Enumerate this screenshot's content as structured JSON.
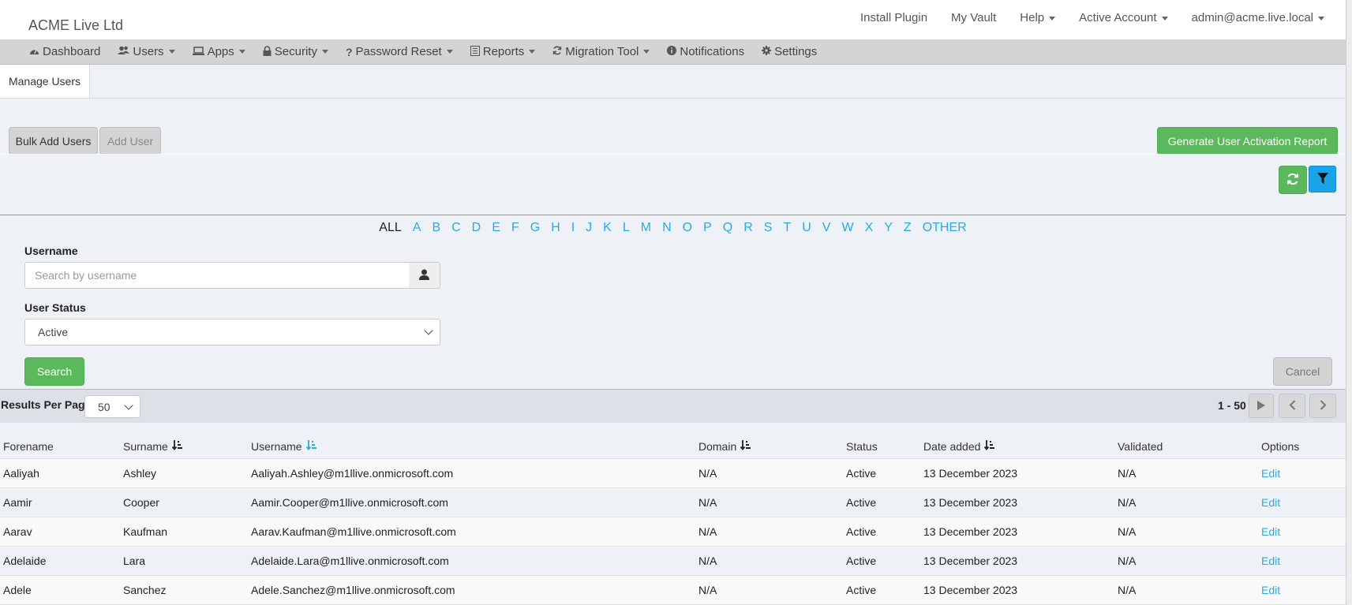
{
  "brand": "ACME Live Ltd",
  "topnav": {
    "install_plugin": "Install Plugin",
    "my_vault": "My Vault",
    "help": "Help",
    "active_account": "Active Account",
    "user": "admin@acme.live.local"
  },
  "mainnav": {
    "dashboard": "Dashboard",
    "users": "Users",
    "apps": "Apps",
    "security": "Security",
    "password_reset": "Password Reset",
    "reports": "Reports",
    "migration_tool": "Migration Tool",
    "notifications": "Notifications",
    "settings": "Settings"
  },
  "tab": {
    "manage_users": "Manage Users"
  },
  "actions": {
    "bulk_add": "Bulk Add Users",
    "add_user": "Add User",
    "generate_report": "Generate User Activation Report"
  },
  "alphabet": [
    "ALL",
    "A",
    "B",
    "C",
    "D",
    "E",
    "F",
    "G",
    "H",
    "I",
    "J",
    "K",
    "L",
    "M",
    "N",
    "O",
    "P",
    "Q",
    "R",
    "S",
    "T",
    "U",
    "V",
    "W",
    "X",
    "Y",
    "Z",
    "OTHER"
  ],
  "filters": {
    "username_label": "Username",
    "username_placeholder": "Search by username",
    "status_label": "User Status",
    "status_value": "Active",
    "search": "Search",
    "cancel": "Cancel"
  },
  "results": {
    "per_page_label": "Results Per Page",
    "per_page_value": "50",
    "range": "1 - 50"
  },
  "table": {
    "headers": {
      "forename": "Forename",
      "surname": "Surname",
      "username": "Username",
      "domain": "Domain",
      "status": "Status",
      "date_added": "Date added",
      "validated": "Validated",
      "options": "Options"
    },
    "rows": [
      {
        "forename": "Aaliyah",
        "surname": "Ashley",
        "username": "Aaliyah.Ashley@m1llive.onmicrosoft.com",
        "domain": "N/A",
        "status": "Active",
        "date_added": "13 December 2023",
        "validated": "N/A",
        "option": "Edit"
      },
      {
        "forename": "Aamir",
        "surname": "Cooper",
        "username": "Aamir.Cooper@m1llive.onmicrosoft.com",
        "domain": "N/A",
        "status": "Active",
        "date_added": "13 December 2023",
        "validated": "N/A",
        "option": "Edit"
      },
      {
        "forename": "Aarav",
        "surname": "Kaufman",
        "username": "Aarav.Kaufman@m1llive.onmicrosoft.com",
        "domain": "N/A",
        "status": "Active",
        "date_added": "13 December 2023",
        "validated": "N/A",
        "option": "Edit"
      },
      {
        "forename": "Adelaide",
        "surname": "Lara",
        "username": "Adelaide.Lara@m1llive.onmicrosoft.com",
        "domain": "N/A",
        "status": "Active",
        "date_added": "13 December 2023",
        "validated": "N/A",
        "option": "Edit"
      },
      {
        "forename": "Adele",
        "surname": "Sanchez",
        "username": "Adele.Sanchez@m1llive.onmicrosoft.com",
        "domain": "N/A",
        "status": "Active",
        "date_added": "13 December 2023",
        "validated": "N/A",
        "option": "Edit"
      }
    ]
  },
  "colors": {
    "accent_blue": "#29abe2",
    "green": "#5cb85c",
    "filter_blue": "#1aa3e8"
  }
}
